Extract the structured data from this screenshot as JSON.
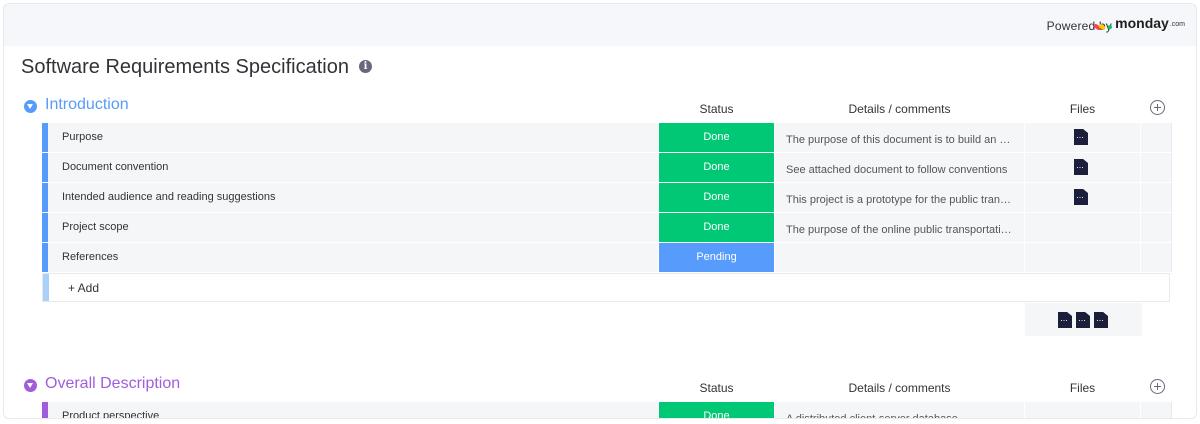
{
  "header": {
    "powered_by": "Powered by",
    "brand": "monday",
    "brand_suffix": ".com",
    "brand_colors": [
      "#ff3d57",
      "#ffcb00",
      "#00ca72"
    ]
  },
  "board": {
    "title": "Software Requirements Specification",
    "info_icon": "info-icon"
  },
  "columns": {
    "status": "Status",
    "details": "Details / comments",
    "files": "Files"
  },
  "colors": {
    "done": "#00c875",
    "pending": "#579bfc",
    "group_intro": "#579bfc",
    "group_overall": "#a25ddc"
  },
  "groups": [
    {
      "title": "Introduction",
      "color": "#579bfc",
      "add_label": "+ Add",
      "items": [
        {
          "name": "Purpose",
          "status": "Done",
          "details": "The purpose of this document is to build an o...",
          "files": 1
        },
        {
          "name": "Document convention",
          "status": "Done",
          "details": "See attached document to follow conventions",
          "files": 1
        },
        {
          "name": "Intended audience and reading suggestions",
          "status": "Done",
          "details": "This project is a prototype for the public trans...",
          "files": 1
        },
        {
          "name": "Project scope",
          "status": "Done",
          "details": "The purpose of the online public transportatio...",
          "files": 0
        },
        {
          "name": "References",
          "status": "Pending",
          "details": "",
          "files": 0
        }
      ],
      "files_summary_count": 3
    },
    {
      "title": "Overall Description",
      "color": "#a25ddc",
      "items": [
        {
          "name": "Product perspective",
          "status": "Done",
          "details": "A distributed client-server database",
          "files": 0
        }
      ]
    }
  ]
}
